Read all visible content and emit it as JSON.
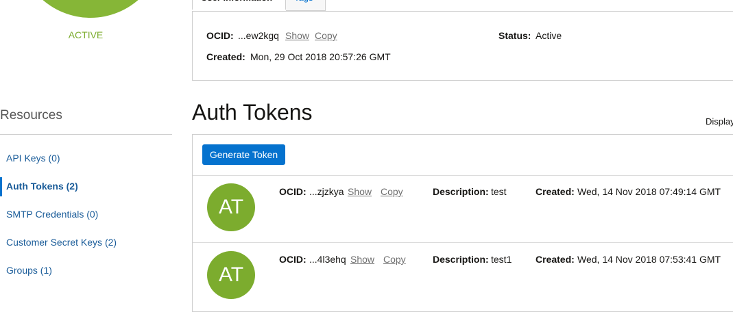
{
  "profile": {
    "status_label": "ACTIVE"
  },
  "tabs": [
    {
      "label": "User Information"
    },
    {
      "label": "Tags"
    }
  ],
  "user_info": {
    "ocid_label": "OCID:",
    "ocid_value": "...ew2kgq",
    "show_label": "Show",
    "copy_label": "Copy",
    "status_label": "Status:",
    "status_value": "Active",
    "created_label": "Created:",
    "created_value": "Mon, 29 Oct 2018 20:57:26 GMT"
  },
  "resources": {
    "title": "Resources",
    "items": [
      {
        "label": "API Keys (0)"
      },
      {
        "label": "Auth Tokens (2)"
      },
      {
        "label": "SMTP Credentials (0)"
      },
      {
        "label": "Customer Secret Keys (2)"
      },
      {
        "label": "Groups (1)"
      }
    ]
  },
  "auth_tokens": {
    "title": "Auth Tokens",
    "display_label": "Display",
    "generate_button": "Generate Token",
    "rows": [
      {
        "avatar": "AT",
        "ocid_label": "OCID:",
        "ocid_value": "...zjzkya",
        "show_label": "Show",
        "copy_label": "Copy",
        "description_label": "Description:",
        "description_value": "test",
        "created_label": "Created:",
        "created_value": "Wed, 14 Nov 2018 07:49:14 GMT"
      },
      {
        "avatar": "AT",
        "ocid_label": "OCID:",
        "ocid_value": "...4l3ehq",
        "show_label": "Show",
        "copy_label": "Copy",
        "description_label": "Description:",
        "description_value": "test1",
        "created_label": "Created:",
        "created_value": "Wed, 14 Nov 2018 07:53:41 GMT"
      }
    ]
  },
  "colors": {
    "accent": "#0572ce",
    "avatar_green": "#7cac2e",
    "link": "#1a5c99"
  }
}
